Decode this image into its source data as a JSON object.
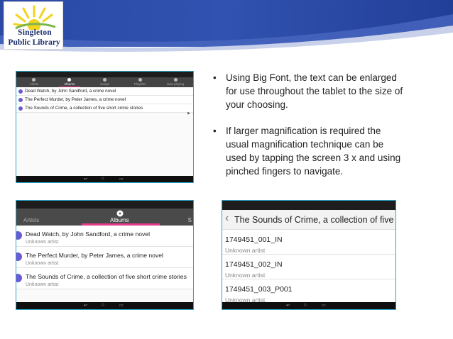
{
  "colors": {
    "header_dark": "#1f3c8f",
    "header_mid": "#3f5ab3",
    "header_light": "#c8d0ea",
    "accent_pink": "#e23b8a",
    "avatar_purple": "#6b5bd2",
    "frame_blue": "#2aa6c9"
  },
  "logo": {
    "line1": "Singleton",
    "line2": "Public Library"
  },
  "bullets": [
    "Using Big Font, the text can be enlarged for use throughout the tablet to the size of your choosing.",
    "If larger magnification is required the usual magnification technique can be used by tapping the screen 3 x and using pinched fingers to navigate."
  ],
  "screen_small": {
    "tabs": [
      "Artists",
      "Albums",
      "Songs",
      "Playlists",
      "Now playing"
    ],
    "selected_tab": "Albums",
    "rows": [
      "Dead Watch, by John Sandford, a crime novel",
      "The Perfect Murder, by Peter James, a crime novel",
      "The Sounds of Crime, a collection of five short crime stories"
    ]
  },
  "screen_albums": {
    "tab_artists": "Artists",
    "tab_albums": "Albums",
    "rows": [
      {
        "title": "Dead Watch, by John Sandford, a crime novel",
        "sub": "Unknown artist"
      },
      {
        "title": "The Perfect Murder, by Peter James, a crime novel",
        "sub": "Unknown artist"
      },
      {
        "title": "The Sounds of Crime, a collection of five short crime stories",
        "sub": "Unknown artist"
      }
    ]
  },
  "screen_tracks": {
    "title": "The Sounds of Crime, a collection of five short crime stories",
    "rows": [
      {
        "title": "1749451_001_IN",
        "sub": "Unknown artist"
      },
      {
        "title": "1749451_002_IN",
        "sub": "Unknown artist"
      },
      {
        "title": "1749451_003_P001",
        "sub": "Unknown artist"
      }
    ]
  },
  "icons": {
    "back": "chevron-left-icon",
    "nav_back": "back-icon",
    "nav_home": "home-icon",
    "nav_recents": "recents-icon"
  }
}
